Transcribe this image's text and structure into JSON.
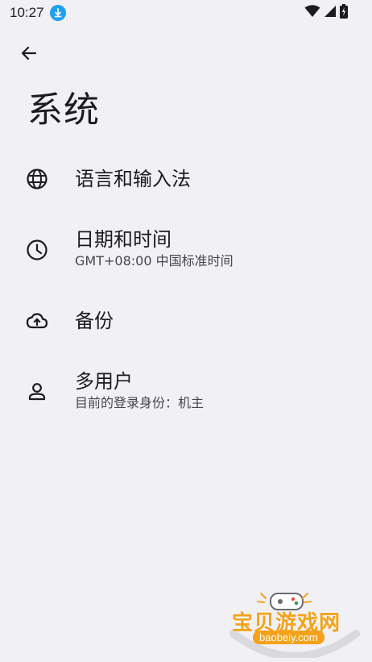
{
  "status_bar": {
    "time": "10:27",
    "icons": [
      "download-icon",
      "wifi-icon",
      "signal-icon",
      "battery-charging-icon"
    ]
  },
  "header": {
    "back_icon": "arrow-back-icon",
    "title": "系统"
  },
  "settings": [
    {
      "icon": "globe-icon",
      "title": "语言和输入法",
      "summary": ""
    },
    {
      "icon": "clock-icon",
      "title": "日期和时间",
      "summary": "GMT+08:00 中国标准时间"
    },
    {
      "icon": "cloud-upload-icon",
      "title": "备份",
      "summary": ""
    },
    {
      "icon": "person-icon",
      "title": "多用户",
      "summary": "目前的登录身份：机主"
    }
  ],
  "watermark": {
    "title": "宝贝游戏网",
    "url": "baobeiy.com"
  },
  "colors": {
    "background": "#f1f0f5",
    "text_primary": "#1c1b1f",
    "text_secondary": "#46454d",
    "download_badge": "#1ea1f1",
    "watermark_accent": "#f3a21a"
  }
}
